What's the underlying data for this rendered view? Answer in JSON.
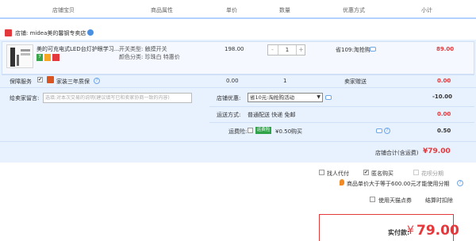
{
  "header": {
    "col_shop": "店铺宝贝",
    "col_attr": "商品属性",
    "col_price": "单价",
    "col_qty": "数量",
    "col_discount": "优惠方式",
    "col_subtotal": "小计"
  },
  "shop": {
    "label": "店铺: midea美的馨钢专卖店"
  },
  "item": {
    "title": "美的可充电式LED台灯护眼学习...",
    "badge_7": "7",
    "attr_switch": "开关类型: 触摸开关",
    "attr_color": "颜色分类: 珍珠白 特惠价",
    "price": "198.00",
    "qty": "1",
    "qty_minus": "-",
    "qty_plus": "+",
    "discount": "省109:淘抢购",
    "subtotal": "89.00"
  },
  "service": {
    "label": "保障服务",
    "check": "✔",
    "name": "家装三年质保",
    "price": "0.00",
    "qty": "1",
    "discount": "卖家赠送",
    "subtotal": "0.00"
  },
  "message": {
    "label": "给卖家留言:",
    "placeholder": "选填:对本次交易的说明(建议填写已和卖家协商一致的内容)"
  },
  "shop_discount": {
    "label": "店铺优惠:",
    "selected": "省10元:淘抢购活动",
    "value": "-10.00"
  },
  "shipping": {
    "label": "运送方式:",
    "value": "普通配送 快递 免邮",
    "amount": "0.00"
  },
  "freight_insurance": {
    "label": "运费险:",
    "badge": "运费险",
    "text": "¥0.50购买",
    "amount": "0.50"
  },
  "shop_total": {
    "label": "店铺合计(含运费)",
    "value": "¥79.00"
  },
  "options": {
    "proxy_pay": "找人代付",
    "anonymous": "匿名购买",
    "installment": "花呗分期",
    "check": "✔",
    "note": "商品单价大于等于600.00元才能使用分期"
  },
  "tmall_points": {
    "label": "使用天猫点券",
    "note": "结算时扣除"
  },
  "final": {
    "label": "实付款:",
    "currency": "¥",
    "value": "79.00"
  },
  "colors": {
    "accent_red": "#e4393c",
    "header_border": "#b2d1ff",
    "panel_blue": "#e8f2ff"
  }
}
